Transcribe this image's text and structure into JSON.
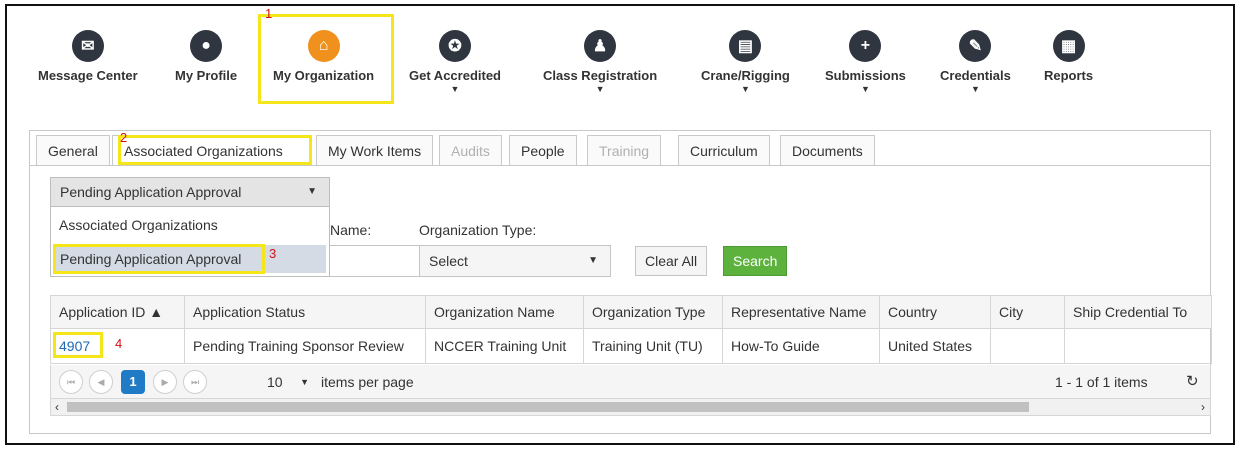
{
  "nav": {
    "items": [
      {
        "label": "Message Center",
        "icon": "envelope-icon",
        "glyph": "✉"
      },
      {
        "label": "My Profile",
        "icon": "person-icon",
        "glyph": "●"
      },
      {
        "label": "My Organization",
        "icon": "building-icon",
        "glyph": "⌂"
      },
      {
        "label": "Get Accredited",
        "icon": "ribbon-icon",
        "glyph": "✪"
      },
      {
        "label": "Class Registration",
        "icon": "presenter-icon",
        "glyph": "♟"
      },
      {
        "label": "Crane/Rigging",
        "icon": "document-icon",
        "glyph": "▤"
      },
      {
        "label": "Submissions",
        "icon": "add-document-icon",
        "glyph": "+"
      },
      {
        "label": "Credentials",
        "icon": "edit-icon",
        "glyph": "✎"
      },
      {
        "label": "Reports",
        "icon": "report-icon",
        "glyph": "▦"
      }
    ],
    "active_color": "#f0911e"
  },
  "annotations": [
    "1",
    "2",
    "3",
    "4"
  ],
  "tabs": [
    "General",
    "Associated Organizations",
    "My Work Items",
    "Audits",
    "People",
    "Training",
    "Curriculum",
    "Documents"
  ],
  "view_selector": {
    "value": "Pending Application Approval",
    "options": [
      "Associated Organizations",
      "Pending Application Approval"
    ]
  },
  "filters": {
    "name_label": "Name:",
    "org_type_label": "Organization Type:",
    "org_type_value": "Select",
    "clear_label": "Clear All",
    "search_label": "Search"
  },
  "grid": {
    "columns": [
      "Application ID ▲",
      "Application Status",
      "Organization Name",
      "Organization Type",
      "Representative Name",
      "Country",
      "City",
      "Ship Credential To"
    ],
    "rows": [
      [
        "4907",
        "Pending Training Sponsor Review",
        "NCCER Training Unit",
        "Training Unit (TU)",
        "How-To Guide",
        "United States",
        "",
        ""
      ]
    ]
  },
  "pager": {
    "current_page": "1",
    "page_size": "10",
    "per_page_label": "items per page",
    "summary": "1 - 1 of 1 items"
  }
}
